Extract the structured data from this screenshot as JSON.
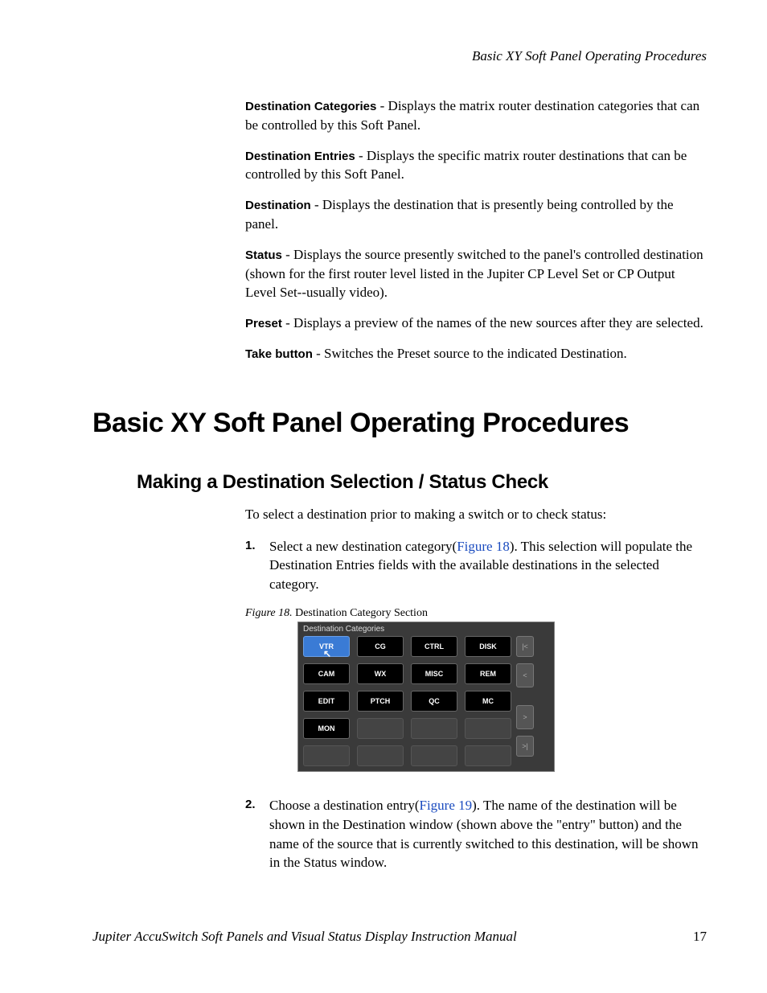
{
  "header": {
    "running_title": "Basic XY Soft Panel Operating Procedures"
  },
  "definitions": [
    {
      "term": "Destination Categories",
      "desc": " - Displays the matrix router destination categories that can be controlled by this Soft Panel."
    },
    {
      "term": "Destination Entries",
      "desc": " - Displays the specific matrix router destinations that can be controlled by this Soft Panel."
    },
    {
      "term": "Destination",
      "desc": " - Displays the destination that is presently being controlled by the panel."
    },
    {
      "term": "Status",
      "desc": " - Displays the source presently switched to the panel's controlled destination (shown for the first router level listed in the Jupiter CP Level Set or CP Output Level Set--usually video)."
    },
    {
      "term": "Preset",
      "desc": " - Displays a preview of the names of the new sources after they are selected."
    },
    {
      "term": "Take button",
      "desc": " - Switches the Preset source to the indicated Destination."
    }
  ],
  "section": {
    "heading": "Basic XY Soft Panel Operating Procedures",
    "subsection": "Making a Destination Selection / Status Check",
    "intro": "To select a destination prior to making a switch or to check status:",
    "steps": [
      {
        "num": "1.",
        "pre": "Select a new destination category(",
        "link": "Figure 18",
        "post": "). This selection will populate the Destination Entries fields with the available destinations in the selected category."
      },
      {
        "num": "2.",
        "pre": "Choose a destination entry(",
        "link": "Figure 19",
        "post": "). The name of the destination will be shown in the Destination window (shown above the \"entry\" button) and the name of the source that is currently switched to this destination, will be shown in the Status window."
      }
    ]
  },
  "figure": {
    "caption_label": "Figure 18.  ",
    "caption_text": "Destination Category Section",
    "panel_title": "Destination Categories",
    "buttons": [
      "VTR",
      "CG",
      "CTRL",
      "DISK",
      "CAM",
      "WX",
      "MISC",
      "REM",
      "EDIT",
      "PTCH",
      "QC",
      "MC",
      "MON",
      "",
      "",
      "",
      "",
      "",
      "",
      ""
    ],
    "nav": [
      "|<",
      "<",
      ">",
      ">|"
    ]
  },
  "footer": {
    "manual_title": "Jupiter AccuSwitch Soft Panels and Visual Status Display Instruction Manual",
    "page_number": "17"
  }
}
